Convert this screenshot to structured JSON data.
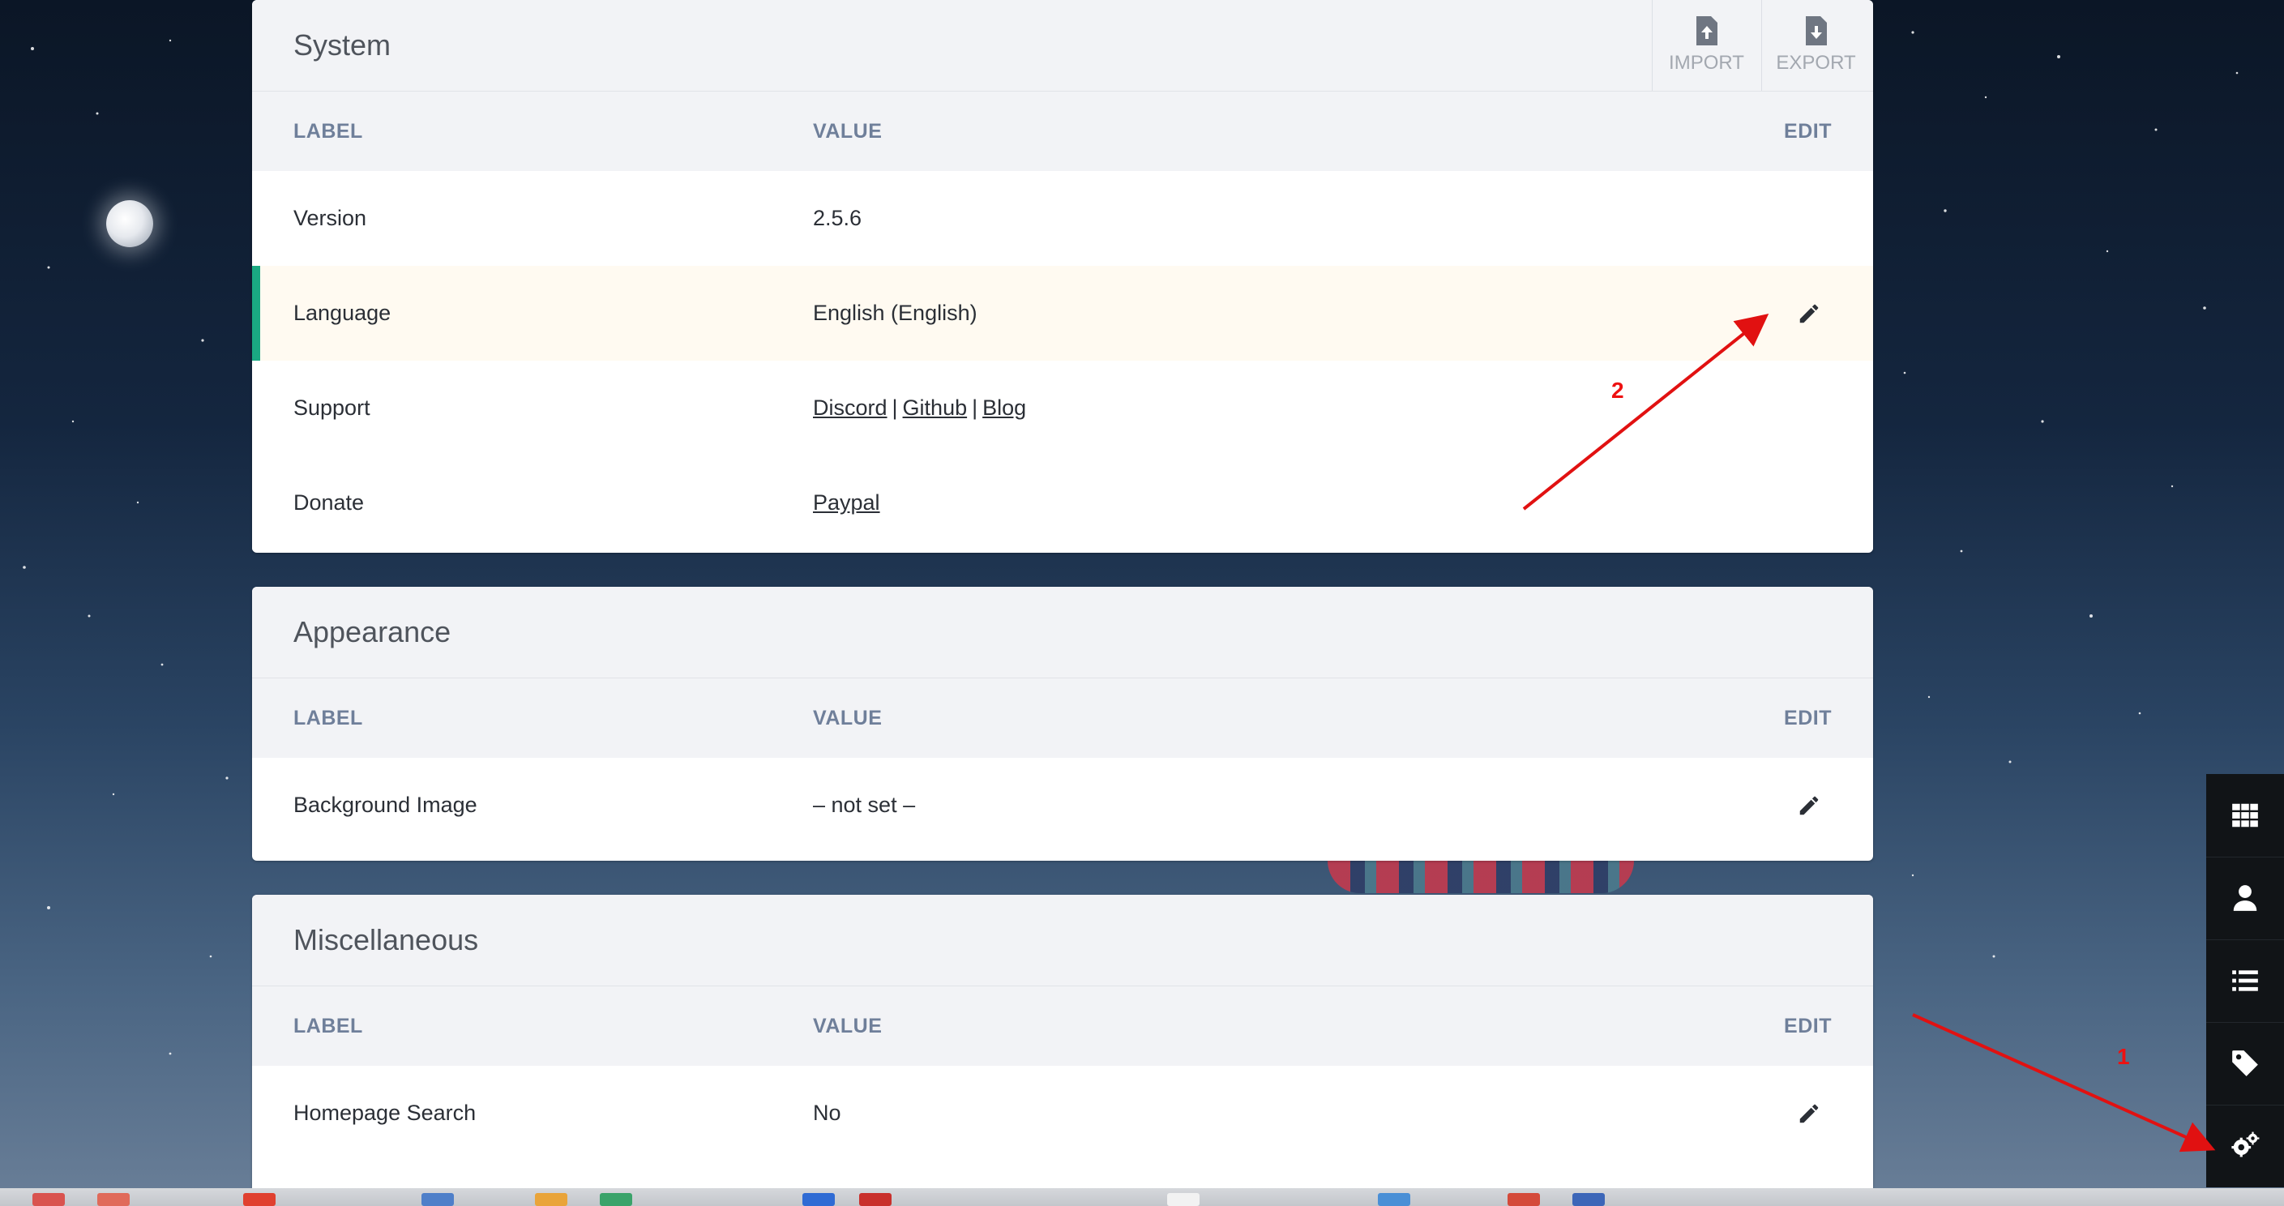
{
  "panels": {
    "system": {
      "title": "System",
      "import_label": "IMPORT",
      "export_label": "EXPORT",
      "columns": {
        "label": "LABEL",
        "value": "VALUE",
        "edit": "EDIT"
      },
      "rows": {
        "version": {
          "label": "Version",
          "value": "2.5.6"
        },
        "language": {
          "label": "Language",
          "value": "English (English)"
        },
        "support": {
          "label": "Support",
          "links": [
            "Discord",
            "Github",
            "Blog"
          ],
          "separator": "|"
        },
        "donate": {
          "label": "Donate",
          "link": "Paypal"
        }
      }
    },
    "appearance": {
      "title": "Appearance",
      "columns": {
        "label": "LABEL",
        "value": "VALUE",
        "edit": "EDIT"
      },
      "rows": {
        "background_image": {
          "label": "Background Image",
          "value": "– not set –"
        }
      }
    },
    "misc": {
      "title": "Miscellaneous",
      "columns": {
        "label": "LABEL",
        "value": "VALUE",
        "edit": "EDIT"
      },
      "rows": {
        "homepage_search": {
          "label": "Homepage Search",
          "value": "No"
        }
      }
    }
  },
  "sidebar": {
    "items": [
      "grid-icon",
      "user-icon",
      "list-icon",
      "tag-icon",
      "settings-gears-icon"
    ]
  },
  "annotations": {
    "one": "1",
    "two": "2"
  },
  "colors": {
    "accent_stripe": "#1aa982",
    "annotation_red": "#e11111",
    "sidebar_bg": "#111417"
  }
}
